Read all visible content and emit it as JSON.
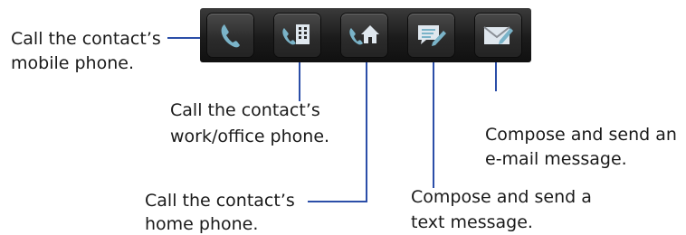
{
  "toolbar": {
    "buttons": [
      {
        "icon": "mobile-phone-icon"
      },
      {
        "icon": "work-phone-icon"
      },
      {
        "icon": "home-phone-icon"
      },
      {
        "icon": "text-message-icon"
      },
      {
        "icon": "email-message-icon"
      }
    ],
    "colors": {
      "background": "#1b1b1b",
      "icon": "#7ab3c8",
      "leader_line": "#2b4ea8"
    }
  },
  "callouts": {
    "mobile": {
      "line1": "Call the contact’s",
      "line2": "mobile phone."
    },
    "work": {
      "line1": "Call the contact’s",
      "line2": "work/office phone."
    },
    "home": {
      "line1": "Call the contact’s",
      "line2": "home phone."
    },
    "text": {
      "line1": "Compose and send a",
      "line2": "text message."
    },
    "email": {
      "line1": "Compose and send an",
      "line2": "e-mail message."
    }
  }
}
